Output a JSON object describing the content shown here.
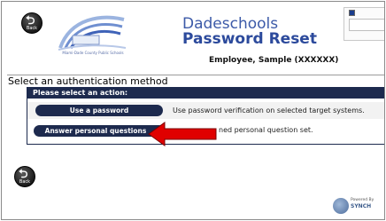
{
  "header": {
    "back_label": "Back",
    "org_caption": "Miami-Dade County Public Schools",
    "brand_line1": "Dadeschools",
    "brand_line2": "Password Reset",
    "user_display": "Employee, Sample (XXXXXX)"
  },
  "main": {
    "section_title": "Select an authentication method",
    "panel_title": "Please select an action:",
    "options": [
      {
        "button_label": "Use a password",
        "description": "Use password verification on selected target systems."
      },
      {
        "button_label": "Answer personal questions",
        "description": "ned personal question set."
      }
    ]
  },
  "footer": {
    "back_label": "Back",
    "powered_by": "Powered By",
    "vendor": "SYNCH"
  },
  "colors": {
    "accent": "#1d2a4e",
    "brand": "#2c4a9c",
    "annotation_arrow": "#e00000"
  }
}
